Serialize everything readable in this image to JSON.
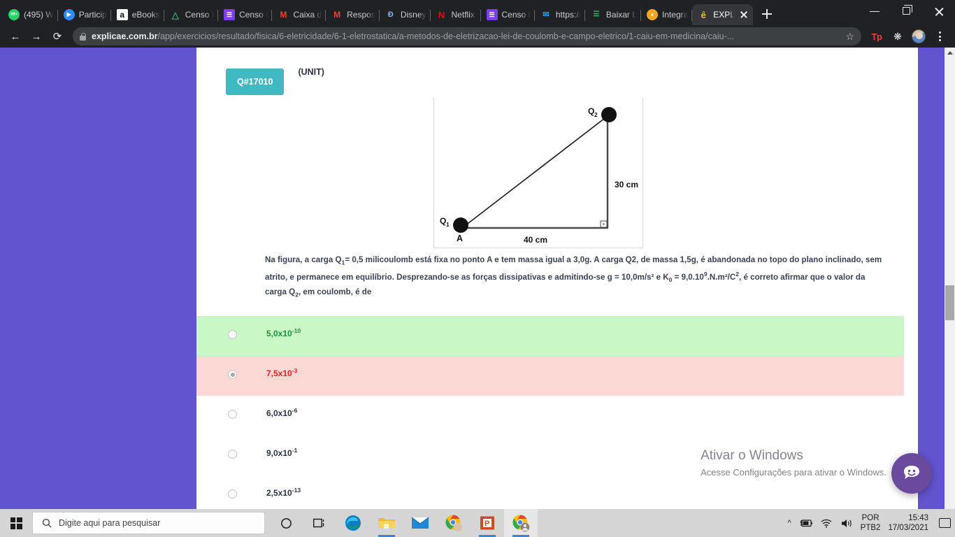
{
  "browser": {
    "tabs": [
      {
        "title": "(495) W",
        "icon": "whatsapp-icon",
        "active": false
      },
      {
        "title": "Particip",
        "icon": "zoom-icon",
        "active": false
      },
      {
        "title": "eBooks",
        "icon": "amazon-icon",
        "active": false
      },
      {
        "title": "Censo I",
        "icon": "google-drive-icon",
        "active": false
      },
      {
        "title": "Censo I",
        "icon": "google-sheets-icon",
        "active": false
      },
      {
        "title": "Caixa d",
        "icon": "gmail-icon",
        "active": false
      },
      {
        "title": "Respos",
        "icon": "gmail-icon",
        "active": false
      },
      {
        "title": "Disney",
        "icon": "disney-plus-icon",
        "active": false
      },
      {
        "title": "Netflix",
        "icon": "netflix-icon",
        "active": false
      },
      {
        "title": "Censo I",
        "icon": "google-sheets-icon",
        "active": false
      },
      {
        "title": "https://",
        "icon": "twitter-icon",
        "active": false
      },
      {
        "title": "Baixar L",
        "icon": "evernote-icon",
        "active": false
      },
      {
        "title": "Integra",
        "icon": "mango-icon",
        "active": false
      },
      {
        "title": "EXPL",
        "icon": "explicae-icon",
        "active": true
      }
    ],
    "new_tab_label": "+",
    "url_domain": "explicae.com.br",
    "url_path": "/app/exercicios/resultado/fisica/6-eletricidade/6-1-eletrostatica/a-metodos-de-eletrizacao-lei-de-coulomb-e-campo-eletrico/1-caiu-em-medicina/caiu-...",
    "back_label": "←",
    "forward_label": "→",
    "reload_label": "⟳",
    "bookmark_label": "☆",
    "tp_extension_label": "Tp"
  },
  "question": {
    "badge": "Q#17010",
    "source": "(UNIT)",
    "text_line1_a": "Na figura, a carga Q",
    "text_line1_sub": "1",
    "text_line1_b": "= 0,5 milicoulomb está fixa no ponto A e tem massa igual a 3,0g. A carga Q2, de massa 1,5g, é abandonada no topo do plano inclinado,",
    "text_line2_a": "sem atrito, e permanece em equilíbrio. Desprezando-se as forças dissipativas e admitindo-se g = 10,0m/s² e   K",
    "text_line2_sub": "0",
    "text_line2_b": " = 9,0.10",
    "text_line2_sup": "9",
    "text_line2_c": ".N.m²/C",
    "text_line2_sup2": "2",
    "text_line2_d": ", é correto afirmar que o",
    "text_line3_a": "valor da carga Q",
    "text_line3_sub": "2",
    "text_line3_b": ", em coulomb, é de",
    "figure": {
      "label_q1": "Q",
      "label_q1_sub": "1",
      "label_q2": "Q",
      "label_q2_sub": "2",
      "label_point_a": "A",
      "label_vertical": "30 cm",
      "label_horizontal": "40 cm"
    },
    "options": [
      {
        "mantissa": "5,0x10",
        "exponent": "-10",
        "state": "correct",
        "selected": false
      },
      {
        "mantissa": "7,5x10",
        "exponent": "-3",
        "state": "chosen",
        "selected": true
      },
      {
        "mantissa": "6,0x10",
        "exponent": "-6",
        "state": "neutral",
        "selected": false
      },
      {
        "mantissa": "9,0x10",
        "exponent": "-1",
        "state": "neutral",
        "selected": false
      },
      {
        "mantissa": "2,5x10",
        "exponent": "-13",
        "state": "neutral",
        "selected": false
      }
    ]
  },
  "watermark": {
    "line1": "Ativar o Windows",
    "line2": "Acesse Configurações para ativar o Windows."
  },
  "taskbar": {
    "search_placeholder": "Digite aqui para pesquisar",
    "cortana_label": "○",
    "taskview_label": "task-view",
    "apps": [
      {
        "name": "edge-icon"
      },
      {
        "name": "file-explorer-icon"
      },
      {
        "name": "mail-icon"
      },
      {
        "name": "chrome-profile-icon"
      },
      {
        "name": "powerpoint-icon"
      },
      {
        "name": "chrome-active-icon"
      }
    ],
    "lang_line1": "POR",
    "lang_line2": "PTB2",
    "time": "15:43",
    "date": "17/03/2021"
  },
  "colors": {
    "page_background": "#6253ce",
    "badge": "#41b9c3",
    "correct_row": "#c9f7c6",
    "chosen_row": "#fcd9d5",
    "correct_text": "#1f8f3e",
    "chosen_text": "#e8211c"
  }
}
